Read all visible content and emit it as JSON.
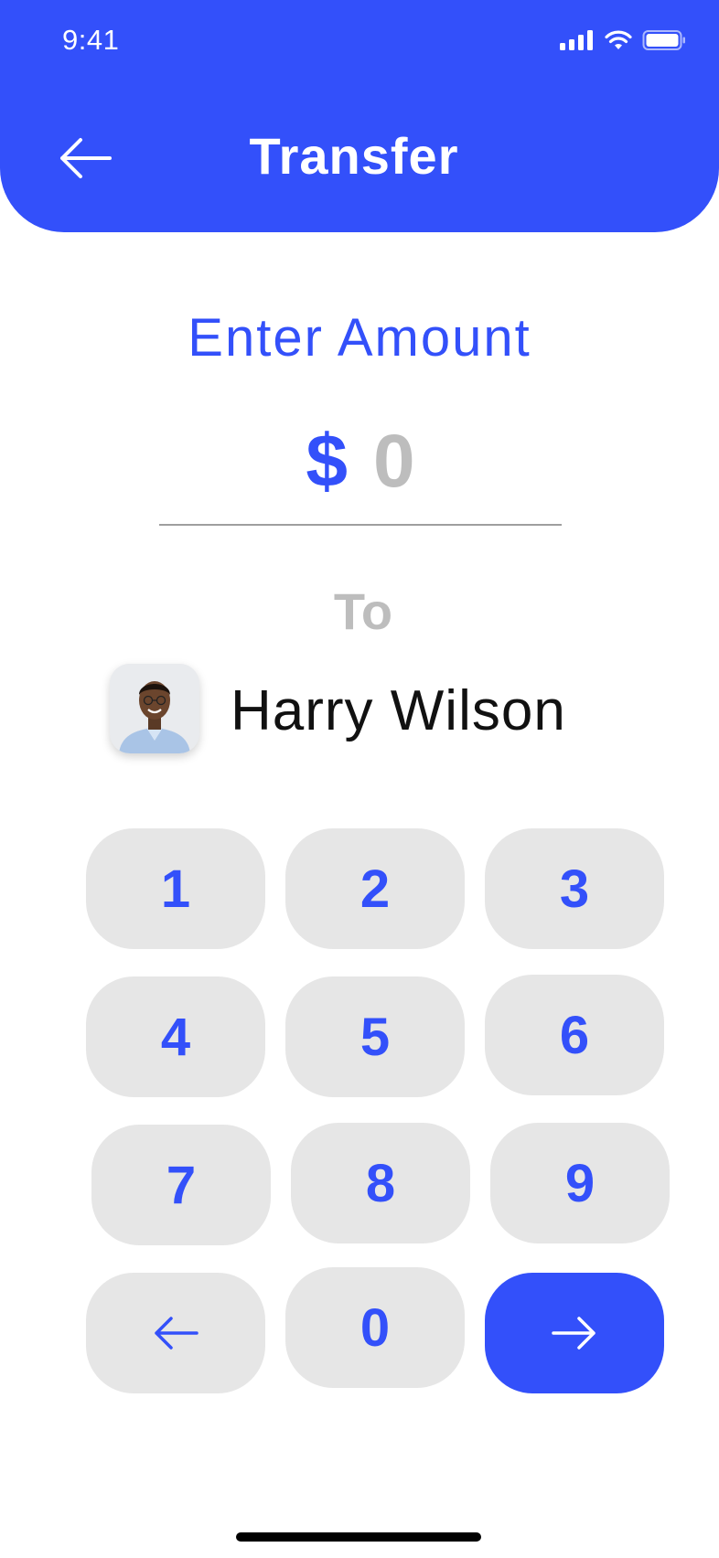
{
  "status_bar": {
    "time": "9:41"
  },
  "header": {
    "title": "Transfer",
    "back_icon": "arrow-left-icon"
  },
  "amount": {
    "label": "Enter Amount",
    "currency": "$",
    "value": "0"
  },
  "recipient": {
    "to_label": "To",
    "name": "Harry Wilson"
  },
  "keypad": {
    "keys": [
      "1",
      "2",
      "3",
      "4",
      "5",
      "6",
      "7",
      "8",
      "9",
      "0"
    ],
    "backspace_icon": "arrow-left-icon",
    "next_icon": "arrow-right-icon"
  },
  "colors": {
    "accent": "#3350FA",
    "key_bg": "#E6E6E6",
    "muted": "#BDBDBD"
  }
}
